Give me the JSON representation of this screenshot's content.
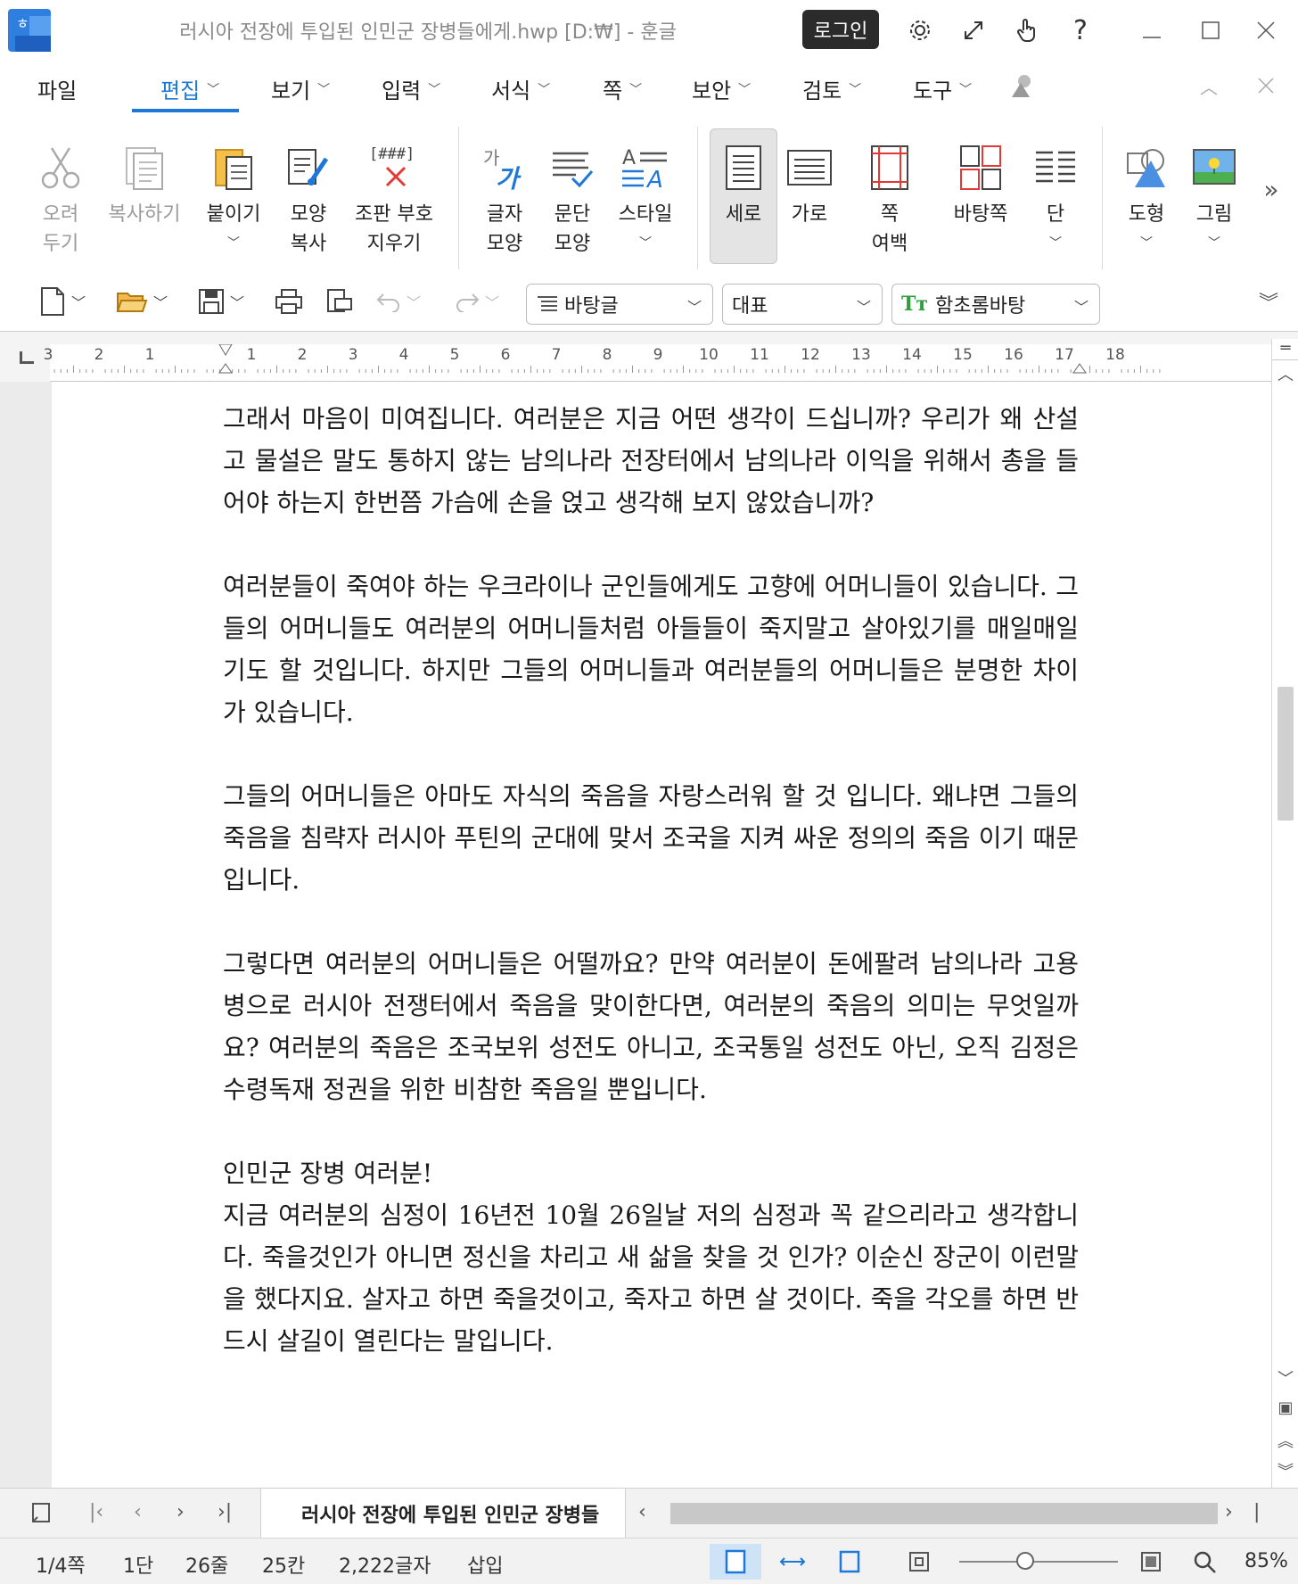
{
  "titlebar": {
    "title": "러시아 전장에 투입된 인민군 장병들에게.hwp [D:₩] - 훈글",
    "login": "로그인"
  },
  "menu": {
    "items": [
      {
        "label": "파일",
        "chevron": false
      },
      {
        "label": "편집",
        "chevron": true,
        "active": true
      },
      {
        "label": "보기",
        "chevron": true
      },
      {
        "label": "입력",
        "chevron": true
      },
      {
        "label": "서식",
        "chevron": true
      },
      {
        "label": "쪽",
        "chevron": true
      },
      {
        "label": "보안",
        "chevron": true
      },
      {
        "label": "검토",
        "chevron": true
      },
      {
        "label": "도구",
        "chevron": true
      }
    ]
  },
  "ribbon": {
    "buttons": [
      {
        "label": "오려\n두기",
        "icon": "scissors-icon",
        "disabled": true
      },
      {
        "label": "복사하기",
        "icon": "copy-icon",
        "disabled": true
      },
      {
        "label": "붙이기",
        "icon": "paste-icon"
      },
      {
        "label": "모양\n복사",
        "icon": "format-painter-icon"
      },
      {
        "label": "조판 부호\n지우기",
        "icon": "clear-codes-icon",
        "code": "[###]"
      },
      {
        "label": "글자\n모양",
        "icon": "char-shape-icon"
      },
      {
        "label": "문단\n모양",
        "icon": "para-shape-icon"
      },
      {
        "label": "스타일",
        "icon": "style-icon"
      },
      {
        "label": "세로",
        "icon": "portrait-icon"
      },
      {
        "label": "가로",
        "icon": "landscape-icon"
      },
      {
        "label": "쪽\n여백",
        "icon": "page-margin-icon"
      },
      {
        "label": "바탕쪽",
        "icon": "master-page-icon"
      },
      {
        "label": "단",
        "icon": "columns-icon"
      },
      {
        "label": "도형",
        "icon": "shape-icon"
      },
      {
        "label": "그림",
        "icon": "picture-icon"
      }
    ]
  },
  "toolbar": {
    "style_combo": "바탕글",
    "lang_combo": "대표",
    "font_combo": "함초롬바탕"
  },
  "ruler": {
    "labels": [
      "3",
      "2",
      "1",
      "",
      "1",
      "2",
      "3",
      "4",
      "5",
      "6",
      "7",
      "8",
      "9",
      "10",
      "11",
      "12",
      "13",
      "14",
      "15",
      "16",
      "17",
      "18"
    ]
  },
  "document": {
    "paragraphs": [
      "그래서 마음이 미여집니다. 여러분은 지금 어떤 생각이 드십니까? 우리가 왜 산설고 물설은 말도 통하지 않는 남의나라 전장터에서 남의나라 이익을 위해서 총을 들어야 하는지 한번쯤 가슴에 손을 얹고 생각해 보지 않았습니까?",
      "여러분들이 죽여야 하는 우크라이나 군인들에게도 고향에 어머니들이 있습니다. 그들의 어머니들도 여러분의 어머니들처럼 아들들이 죽지말고 살아있기를 매일매일 기도 할 것입니다. 하지만 그들의 어머니들과 여러분들의 어머니들은 분명한 차이가 있습니다.",
      "그들의 어머니들은 아마도 자식의 죽음을 자랑스러워 할 것 입니다. 왜냐면 그들의 죽음을 침략자 러시아 푸틴의 군대에 맞서 조국을 지켜 싸운 정의의 죽음 이기 때문 입니다.",
      "그렇다면 여러분의 어머니들은 어떨까요? 만약 여러분이 돈에팔려 남의나라 고용병으로 러시아 전쟁터에서 죽음을 맞이한다면, 여러분의 죽음의 의미는 무엇일까요? 여러분의 죽음은 조국보위 성전도 아니고, 조국통일 성전도 아닌, 오직 김정은 수령독재 정권을 위한 비참한 죽음일 뿐입니다.",
      "인민군 장병 여러분!",
      "지금 여러분의 심정이 16년전 10월 26일날 저의 심정과 꼭 같으리라고 생각합니다. 죽을것인가 아니면 정신을 차리고 새 삶을 찾을 것 인가? 이순신 장군이 이런말을 했다지요. 살자고 하면 죽을것이고, 죽자고 하면 살 것이다. 죽을 각오를 하면 반드시 살길이 열린다는 말입니다."
    ]
  },
  "tabs": {
    "doc_tab": "러시아 전장에 투입된 인민군 장병들"
  },
  "status": {
    "page": "1/4쪽",
    "column": "1단",
    "line": "26줄",
    "col": "25칸",
    "chars": "2,222글자",
    "mode": "삽입",
    "zoom": "85%"
  },
  "colors": {
    "accent": "#1e78d7",
    "login_bg": "#2b2b2b"
  }
}
